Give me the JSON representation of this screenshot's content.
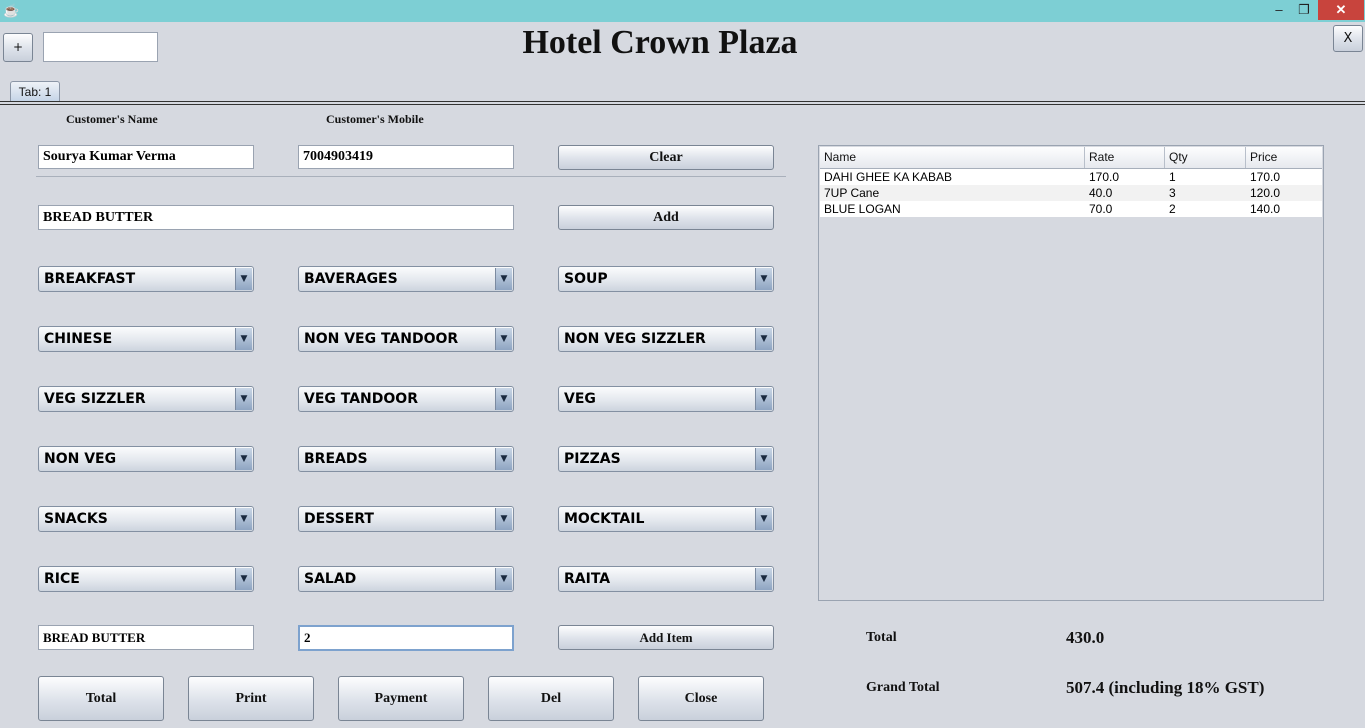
{
  "window": {
    "minimize": "–",
    "restore": "❐",
    "close": "✕"
  },
  "toolbar": {
    "plus_label": "+",
    "tab_number_value": "",
    "x_label": "X"
  },
  "header": {
    "title": "Hotel Crown Plaza"
  },
  "tabs": [
    {
      "label": "Tab: 1"
    }
  ],
  "customer": {
    "name_label": "Customer's Name",
    "mobile_label": "Customer's Mobile",
    "name_value": "Sourya Kumar Verma",
    "mobile_value": "7004903419",
    "clear_label": "Clear"
  },
  "item_search": {
    "value": "BREAD BUTTER",
    "add_label": "Add"
  },
  "categories": [
    "BREAKFAST",
    "BAVERAGES",
    "SOUP",
    "CHINESE",
    "NON VEG TANDOOR",
    "NON VEG SIZZLER",
    "VEG SIZZLER",
    "VEG TANDOOR",
    "VEG",
    "NON VEG",
    "BREADS",
    "PIZZAS",
    "SNACKS",
    "DESSERT",
    "MOCKTAIL",
    "RICE",
    "SALAD",
    "RAITA"
  ],
  "selected_item": {
    "name": "BREAD BUTTER",
    "qty": "2",
    "add_item_label": "Add Item"
  },
  "actions": {
    "total": "Total",
    "print": "Print",
    "payment": "Payment",
    "del": "Del",
    "close": "Close"
  },
  "bill": {
    "columns": [
      "Name",
      "Rate",
      "Qty",
      "Price"
    ],
    "rows": [
      [
        "DAHI GHEE KA KABAB",
        "170.0",
        "1",
        "170.0"
      ],
      [
        "7UP Cane",
        "40.0",
        "3",
        "120.0"
      ],
      [
        "BLUE LOGAN",
        "70.0",
        "2",
        "140.0"
      ]
    ]
  },
  "totals": {
    "total_label": "Total",
    "total_value": "430.0",
    "grand_label": "Grand Total",
    "grand_value": "507.4 (including 18% GST)"
  },
  "colors": {
    "titlebar": "#7dcfd4",
    "close_button": "#c8443d",
    "background": "#d6d9e0"
  }
}
